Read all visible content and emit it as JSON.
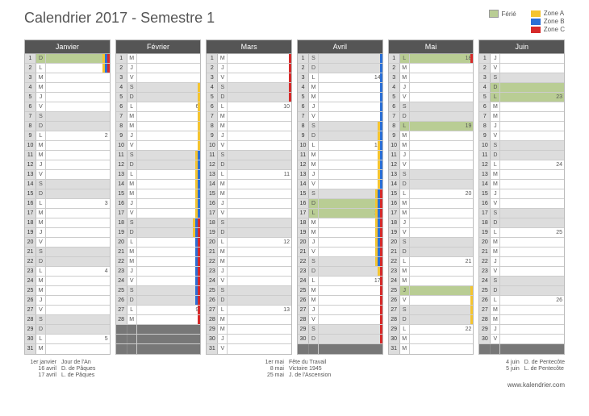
{
  "title": "Calendrier 2017 - Semestre 1",
  "legend": {
    "ferie": "Férié",
    "zones": [
      "Zone A",
      "Zone B",
      "Zone C"
    ]
  },
  "url": "www.kalendrier.com",
  "months": [
    {
      "name": "Janvier",
      "len": 31,
      "firstDow": 6,
      "weeknums": {
        "2": 1,
        "9": 2,
        "16": 3,
        "23": 4,
        "30": 5
      },
      "ferie": [
        1
      ],
      "zones": {
        "1": [
          "a",
          "b",
          "c"
        ],
        "2": [
          "a",
          "b",
          "c"
        ]
      }
    },
    {
      "name": "Février",
      "len": 28,
      "firstDow": 2,
      "weeknums": {
        "6": 6,
        "13": 7,
        "20": 8,
        "27": 9
      },
      "ferie": [],
      "zones": {
        "4": [
          "a"
        ],
        "5": [
          "a"
        ],
        "6": [
          "a"
        ],
        "7": [
          "a"
        ],
        "8": [
          "a"
        ],
        "9": [
          "a"
        ],
        "10": [
          "a"
        ],
        "11": [
          "a",
          "b"
        ],
        "12": [
          "a",
          "b"
        ],
        "13": [
          "a",
          "b"
        ],
        "14": [
          "a",
          "b"
        ],
        "15": [
          "a",
          "b"
        ],
        "16": [
          "a",
          "b"
        ],
        "17": [
          "a",
          "b"
        ],
        "18": [
          "a",
          "b",
          "c"
        ],
        "19": [
          "a",
          "b",
          "c"
        ],
        "20": [
          "b",
          "c"
        ],
        "21": [
          "b",
          "c"
        ],
        "22": [
          "b",
          "c"
        ],
        "23": [
          "b",
          "c"
        ],
        "24": [
          "b",
          "c"
        ],
        "25": [
          "b",
          "c"
        ],
        "26": [
          "b",
          "c"
        ],
        "27": [
          "c"
        ],
        "28": [
          "c"
        ]
      }
    },
    {
      "name": "Mars",
      "len": 31,
      "firstDow": 2,
      "weeknums": {
        "6": 10,
        "13": 11,
        "20": 12,
        "27": 13
      },
      "ferie": [],
      "zones": {
        "1": [
          "c"
        ],
        "2": [
          "c"
        ],
        "3": [
          "c"
        ],
        "4": [
          "c"
        ],
        "5": [
          "c"
        ]
      }
    },
    {
      "name": "Avril",
      "len": 30,
      "firstDow": 5,
      "weeknums": {
        "3": 14,
        "10": 15,
        "17": 16,
        "24": 17
      },
      "ferie": [
        16,
        17
      ],
      "zones": {
        "1": [
          "b"
        ],
        "2": [
          "b"
        ],
        "3": [
          "b"
        ],
        "4": [
          "b"
        ],
        "5": [
          "b"
        ],
        "6": [
          "b"
        ],
        "7": [
          "b"
        ],
        "8": [
          "a",
          "b"
        ],
        "9": [
          "a",
          "b"
        ],
        "10": [
          "a",
          "b"
        ],
        "11": [
          "a",
          "b"
        ],
        "12": [
          "a",
          "b"
        ],
        "13": [
          "a",
          "b"
        ],
        "14": [
          "a",
          "b"
        ],
        "15": [
          "a",
          "b",
          "c"
        ],
        "16": [
          "a",
          "b",
          "c"
        ],
        "17": [
          "a",
          "b",
          "c"
        ],
        "18": [
          "a",
          "b",
          "c"
        ],
        "19": [
          "a",
          "b",
          "c"
        ],
        "20": [
          "a",
          "b",
          "c"
        ],
        "21": [
          "a",
          "b",
          "c"
        ],
        "22": [
          "a",
          "b",
          "c"
        ],
        "23": [
          "a",
          "c"
        ],
        "24": [
          "c"
        ],
        "25": [
          "c"
        ],
        "26": [
          "c"
        ],
        "27": [
          "c"
        ],
        "28": [
          "c"
        ],
        "29": [
          "c"
        ],
        "30": [
          "c"
        ]
      }
    },
    {
      "name": "Mai",
      "len": 31,
      "firstDow": 0,
      "weeknums": {
        "1": 18,
        "8": 19,
        "15": 20,
        "22": 21,
        "29": 22
      },
      "ferie": [
        1,
        8,
        25
      ],
      "zones": {
        "1": [
          "c"
        ],
        "25": [
          "a"
        ],
        "26": [
          "a"
        ],
        "27": [
          "a"
        ],
        "28": [
          "a"
        ]
      }
    },
    {
      "name": "Juin",
      "len": 30,
      "firstDow": 3,
      "weeknums": {
        "5": 23,
        "12": 24,
        "19": 25,
        "26": 26
      },
      "ferie": [
        4,
        5
      ],
      "zones": {}
    }
  ],
  "dows": [
    "L",
    "M",
    "M",
    "J",
    "V",
    "S",
    "D"
  ],
  "notes": [
    [
      {
        "d": "1er janvier",
        "t": "Jour de l'An"
      },
      {
        "d": "16 avril",
        "t": "D. de Pâques"
      },
      {
        "d": "17 avril",
        "t": "L. de Pâques"
      }
    ],
    [
      {
        "d": "1er mai",
        "t": "Fête du Travail"
      },
      {
        "d": "8 mai",
        "t": "Victoire 1945"
      },
      {
        "d": "25 mai",
        "t": "J. de l'Ascension"
      }
    ],
    [
      {
        "d": "4 juin",
        "t": "D. de Pentecôte"
      },
      {
        "d": "5 juin",
        "t": "L. de Pentecôte"
      }
    ]
  ]
}
